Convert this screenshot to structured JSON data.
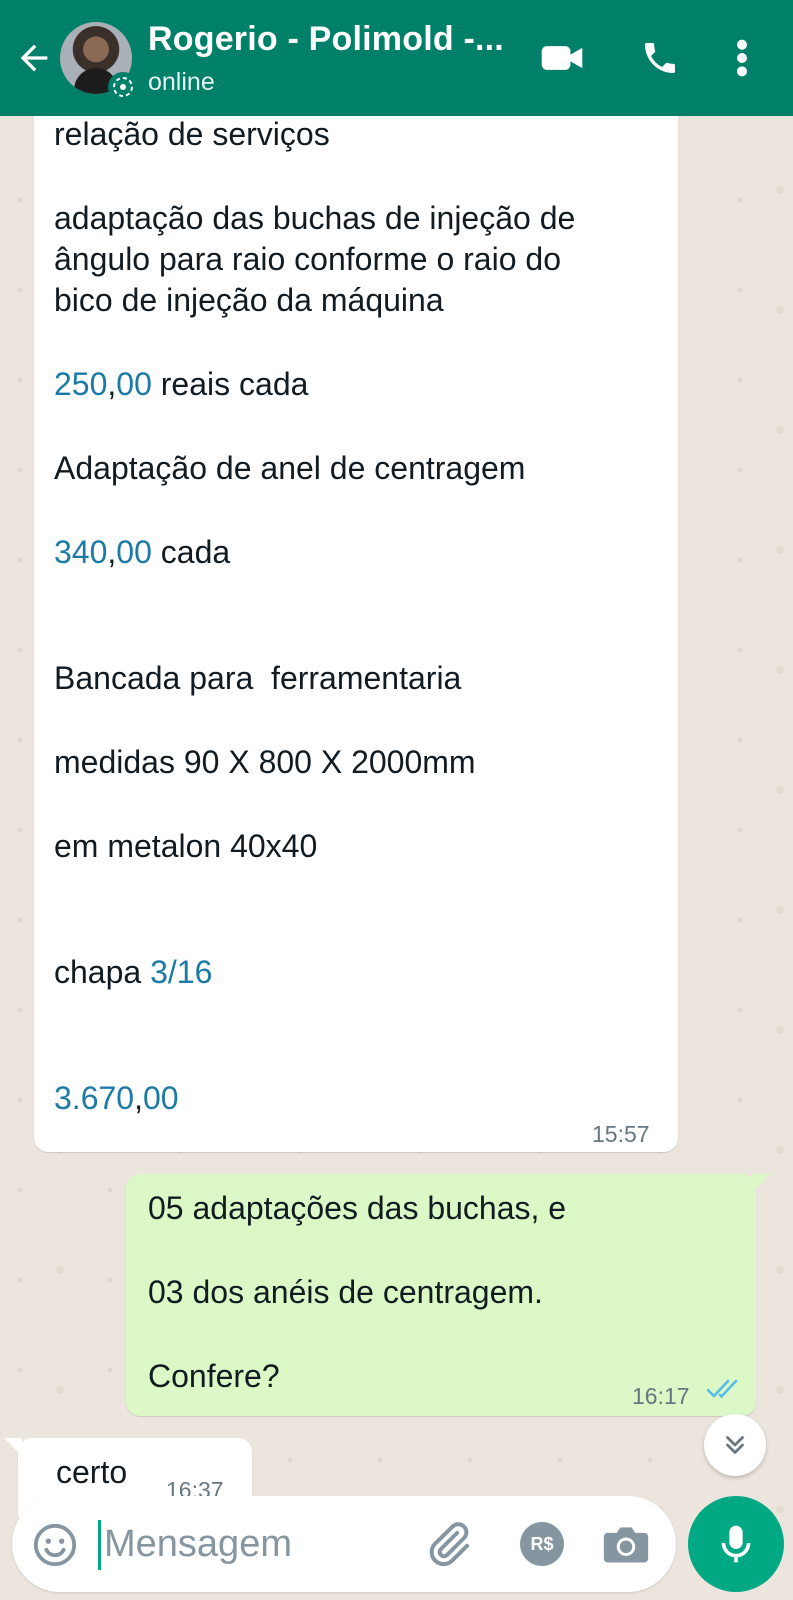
{
  "header": {
    "contact_name": "Rogerio - Polimold -...",
    "status": "online"
  },
  "messages": [
    {
      "direction": "incoming",
      "lines": [
        {
          "parts": [
            {
              "text": "relação de serviços"
            }
          ]
        },
        {
          "parts": [
            {
              "text": "adaptação das buchas de injeção de"
            }
          ]
        },
        {
          "parts": [
            {
              "text": "ângulo para raio conforme o raio do"
            }
          ]
        },
        {
          "parts": [
            {
              "text": "bico de injeção da máquina"
            }
          ]
        },
        {
          "parts": [
            {
              "text": "250",
              "num": true
            },
            {
              "text": ","
            },
            {
              "text": "00",
              "num": true
            },
            {
              "text": " reais cada"
            }
          ]
        },
        {
          "parts": [
            {
              "text": "Adaptação de anel de centragem"
            }
          ]
        },
        {
          "parts": [
            {
              "text": "340",
              "num": true
            },
            {
              "text": ","
            },
            {
              "text": "00",
              "num": true
            },
            {
              "text": " cada"
            }
          ]
        },
        {
          "parts": [
            {
              "text": "Bancada para  ferramentaria"
            }
          ]
        },
        {
          "parts": [
            {
              "text": "medidas 90 X 800 X 2000mm"
            }
          ]
        },
        {
          "parts": [
            {
              "text": "em metalon 40x40"
            }
          ]
        },
        {
          "parts": [
            {
              "text": "chapa "
            },
            {
              "text": "3/16",
              "num": true
            }
          ]
        },
        {
          "parts": [
            {
              "text": "3.670",
              "num": true
            },
            {
              "text": ","
            },
            {
              "text": "00",
              "num": true
            }
          ]
        }
      ],
      "time": "15:57"
    },
    {
      "direction": "outgoing",
      "lines": [
        {
          "parts": [
            {
              "text": "05 adaptações das buchas, e"
            }
          ]
        },
        {
          "parts": [
            {
              "text": "03 dos anéis de centragem."
            }
          ]
        },
        {
          "parts": [
            {
              "text": "Confere?"
            }
          ]
        }
      ],
      "time": "16:17",
      "status": "read"
    },
    {
      "direction": "incoming",
      "lines": [
        {
          "parts": [
            {
              "text": "certo"
            }
          ]
        }
      ],
      "time": "16:37"
    }
  ],
  "composer": {
    "placeholder": "Mensagem",
    "payment_label": "R$"
  },
  "icons": {
    "back": "arrow-left-icon",
    "video": "video-call-icon",
    "call": "phone-icon",
    "menu": "more-vert-icon",
    "emoji": "emoji-icon",
    "attach": "paperclip-icon",
    "camera": "camera-icon",
    "mic": "mic-icon",
    "scroll": "double-chevron-down-icon"
  },
  "colors": {
    "header": "#008069",
    "accent": "#00a884",
    "incoming_bubble": "#ffffff",
    "outgoing_bubble": "#dcf8c6",
    "number_link": "#1b7ba6",
    "read_ticks": "#53bdeb"
  }
}
